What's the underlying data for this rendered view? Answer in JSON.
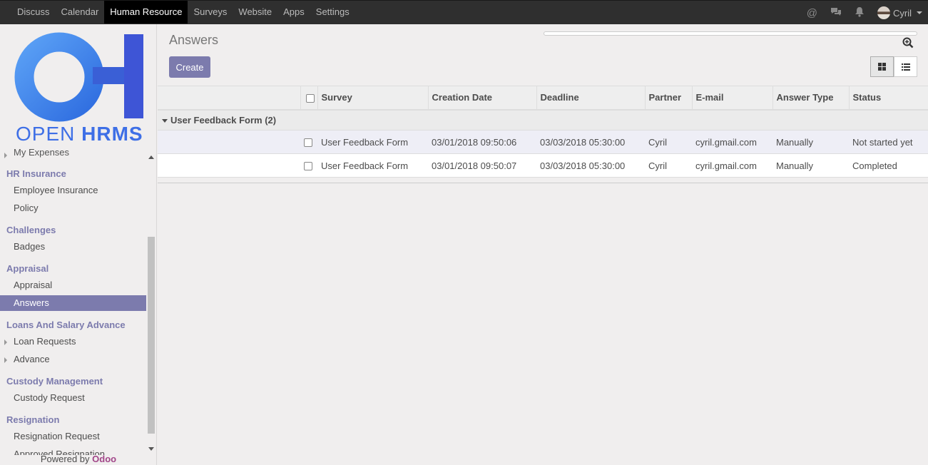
{
  "topbar": {
    "menu": [
      "Discuss",
      "Calendar",
      "Human Resource",
      "Surveys",
      "Website",
      "Apps",
      "Settings"
    ],
    "active_index": 2,
    "user_name": "Cyril"
  },
  "logo": {
    "text_light": "OPEN ",
    "text_bold": "HRMS",
    "color": "#3e6fe6"
  },
  "sidebar": {
    "cut_item": "My Expenses",
    "sections": [
      {
        "heading": "HR Insurance",
        "items": [
          "Employee Insurance",
          "Policy"
        ]
      },
      {
        "heading": "Challenges",
        "items": [
          "Badges"
        ]
      },
      {
        "heading": "Appraisal",
        "items": [
          "Appraisal",
          "Answers"
        ]
      },
      {
        "heading": "Loans And Salary Advance",
        "items": [
          "Loan Requests",
          "Advance"
        ]
      },
      {
        "heading": "Custody Management",
        "items": [
          "Custody Request"
        ]
      },
      {
        "heading": "Resignation",
        "items": [
          "Resignation Request",
          "Approved Resignation"
        ]
      }
    ],
    "active_item": "Answers",
    "powered_by": "Powered by ",
    "powered_brand": "Odoo"
  },
  "control_panel": {
    "title": "Answers",
    "create_label": "Create"
  },
  "list": {
    "columns": [
      "Survey",
      "Creation Date",
      "Deadline",
      "Partner",
      "E-mail",
      "Answer Type",
      "Status"
    ],
    "group_label": "User Feedback Form (2)",
    "rows": [
      {
        "survey": "User Feedback Form",
        "creation_date": "03/01/2018 09:50:06",
        "deadline": "03/03/2018 05:30:00",
        "partner": "Cyril",
        "email": "cyril.gmail.com",
        "answer_type": "Manually",
        "status": "Not started yet"
      },
      {
        "survey": "User Feedback Form",
        "creation_date": "03/01/2018 09:50:07",
        "deadline": "03/03/2018 05:30:00",
        "partner": "Cyril",
        "email": "cyril.gmail.com",
        "answer_type": "Manually",
        "status": "Completed"
      }
    ]
  },
  "colors": {
    "accent": "#7c7bad",
    "topbar": "#2f2f2f",
    "brand_odoo": "#a24689"
  }
}
